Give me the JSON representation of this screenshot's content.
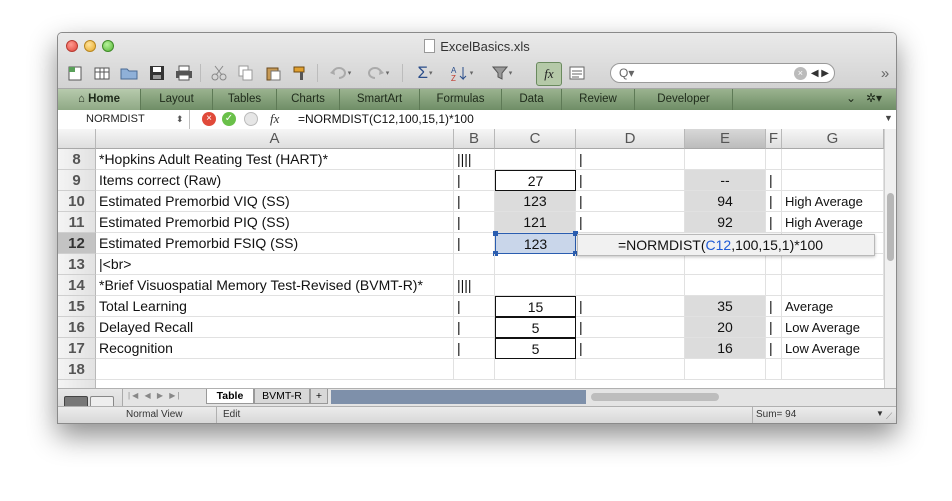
{
  "window": {
    "title": "ExcelBasics.xls"
  },
  "toolbar": {
    "buttons": [
      "new-workbook",
      "templates",
      "open",
      "save",
      "print",
      "cut",
      "copy",
      "paste",
      "format-painter",
      "undo",
      "redo",
      "autosum",
      "sort",
      "filter",
      "formula-builder",
      "show-hide"
    ],
    "autosum_glyph": "Σ",
    "fx_glyph": "fx",
    "search_placeholder": "",
    "overflow_glyph": "»"
  },
  "ribbon": {
    "tabs": [
      "Home",
      "Layout",
      "Tables",
      "Charts",
      "SmartArt",
      "Formulas",
      "Data",
      "Review",
      "Developer"
    ],
    "active": "Home"
  },
  "formula_bar": {
    "name_box": "NORMDIST",
    "fx_label": "fx",
    "formula": "=NORMDIST(C12,100,15,1)*100"
  },
  "columns": [
    "A",
    "B",
    "C",
    "D",
    "E",
    "F",
    "G"
  ],
  "selected_column": "E",
  "rows": [
    {
      "num": "8",
      "A": "*Hopkins Adult Reating Test (HART)*",
      "B": "||||",
      "C": "",
      "D": "|",
      "E": "",
      "F": "",
      "G": ""
    },
    {
      "num": "9",
      "A": "Items correct (Raw)",
      "B": "|",
      "C": "27",
      "D": "|",
      "E": "--",
      "F": "|",
      "G": ""
    },
    {
      "num": "10",
      "A": "Estimated Premorbid VIQ (SS)",
      "B": "|",
      "C": "123",
      "D": "|",
      "E": "94",
      "F": "|",
      "G": "High Average"
    },
    {
      "num": "11",
      "A": "Estimated Premorbid PIQ (SS)",
      "B": "|",
      "C": "121",
      "D": "|",
      "E": "92",
      "F": "|",
      "G": "High Average"
    },
    {
      "num": "12",
      "A": "Estimated Premorbid FSIQ (SS)",
      "B": "|",
      "C": "123",
      "D": "",
      "E": "",
      "F": "",
      "G": ""
    },
    {
      "num": "13",
      "A": "|<br>",
      "B": "",
      "C": "",
      "D": "",
      "E": "",
      "F": "",
      "G": ""
    },
    {
      "num": "14",
      "A": "*Brief Visuospatial Memory Test-Revised (BVMT-R)*",
      "B": "||||",
      "C": "",
      "D": "",
      "E": "",
      "F": "",
      "G": ""
    },
    {
      "num": "15",
      "A": "Total Learning",
      "B": "|",
      "C": "15",
      "D": "|",
      "E": "35",
      "F": "|",
      "G": "Average"
    },
    {
      "num": "16",
      "A": "Delayed Recall",
      "B": "|",
      "C": "5",
      "D": "|",
      "E": "20",
      "F": "|",
      "G": "Low Average"
    },
    {
      "num": "17",
      "A": "Recognition",
      "B": "|",
      "C": "5",
      "D": "|",
      "E": "16",
      "F": "|",
      "G": "Low Average"
    },
    {
      "num": "18",
      "A": "",
      "B": "",
      "C": "",
      "D": "",
      "E": "",
      "F": "",
      "G": ""
    }
  ],
  "active_row": "12",
  "formula_tooltip": {
    "before": "=NORMDIST(",
    "ref": "C12",
    "after": ",100,15,1)*100"
  },
  "sheets": {
    "tabs": [
      "Table",
      "BVMT-R"
    ],
    "active": "Table",
    "add_glyph": "+"
  },
  "status": {
    "view": "Normal View",
    "mode": "Edit",
    "sum": "Sum= 94"
  },
  "colors": {
    "ribbon": "#7d9a73",
    "grey_cell": "#dcdcdc",
    "ref_blue": "#1f5bd6"
  }
}
